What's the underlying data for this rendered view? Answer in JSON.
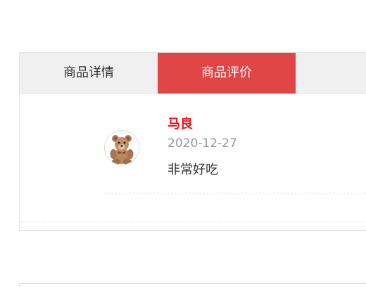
{
  "tabs": {
    "details_label": "商品详情",
    "reviews_label": "商品评价",
    "active": "商品评价"
  },
  "review": {
    "reviewer_name": "马良",
    "date": "2020-12-27",
    "comment": "非常好吃",
    "avatar_icon": "teddy-bear-icon"
  },
  "colors": {
    "accent": "#e04646",
    "reviewer_name": "#e8141b",
    "tabbar_bg": "#f0f0f0"
  }
}
